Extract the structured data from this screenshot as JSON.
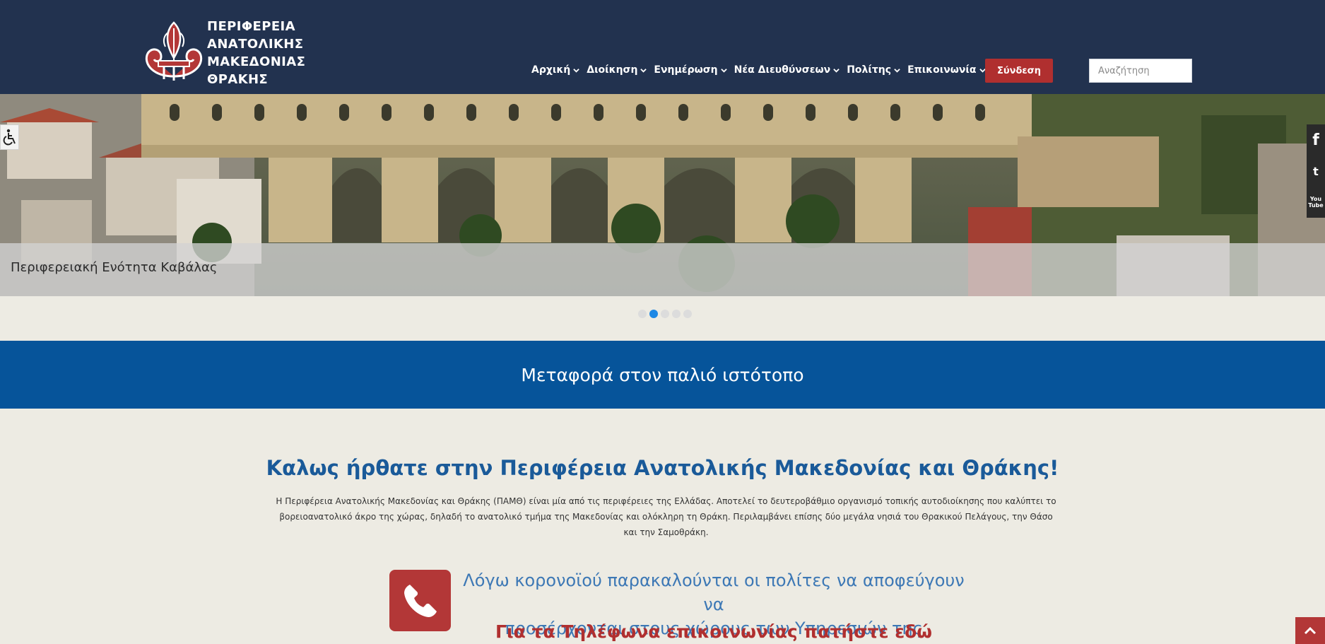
{
  "header": {
    "logo_lines": [
      "ΠΕΡΙΦΕΡΕΙΑ",
      "ΑΝΑΤΟΛΙΚΗΣ",
      "ΜΑΚΕΔΟΝΙΑΣ",
      "ΘΡΑΚΗΣ"
    ],
    "nav": [
      {
        "label": "Αρχική"
      },
      {
        "label": "Διοίκηση"
      },
      {
        "label": "Ενημέρωση"
      },
      {
        "label": "Νέα Διευθύνσεων"
      },
      {
        "label": "Πολίτης"
      },
      {
        "label": "Επικοινωνία"
      }
    ],
    "login_label": "Σύνδεση",
    "search_placeholder": "Αναζήτηση"
  },
  "hero": {
    "caption": "Περιφερειακή Ενότητα Καβάλας",
    "slides_count": 5,
    "active_slide": 2
  },
  "social": {
    "facebook": "f",
    "twitter": "t",
    "youtube_line1": "You",
    "youtube_line2": "Tube"
  },
  "banner": {
    "label": "Μεταφορά στον παλιό ιστότοπο"
  },
  "welcome": {
    "title": "Καλως ήρθατε στην Περιφέρεια Ανατολικής Μακεδονίας και Θράκης!",
    "text": "Η Περιφέρεια Ανατολικής Μακεδονίας και Θράκης (ΠΑΜΘ) είναι μία από τις περιφέρειες της Ελλάδας. Αποτελεί το δευτεροβάθμιο οργανισμό τοπικής αυτοδιοίκησης που καλύπτει το βορειοανατολικό άκρο της χώρας, δηλαδή το ανατολικό τμήμα της Μακεδονίας και ολόκληρη τη Θράκη. Περιλαμβάνει επίσης δύο μεγάλα νησιά του Θρακικού Πελάγους, την Θάσο και την Σαμοθράκη."
  },
  "notice": {
    "line1": "Λόγω κορονοϊού παρακαλούνται οι πολίτες να αποφεύγουν να",
    "line2": "προσέρχονται στους χώρους των Υπηρεσιών της Περιφέρειας",
    "phone_link": "Για τα Τηλέφωνα επικοινωνίας πατήστε εδώ"
  },
  "colors": {
    "header_bg": "#22324f",
    "banner_bg": "#06549a",
    "accent_red": "#b02f2f",
    "title_blue": "#1a5a99"
  }
}
